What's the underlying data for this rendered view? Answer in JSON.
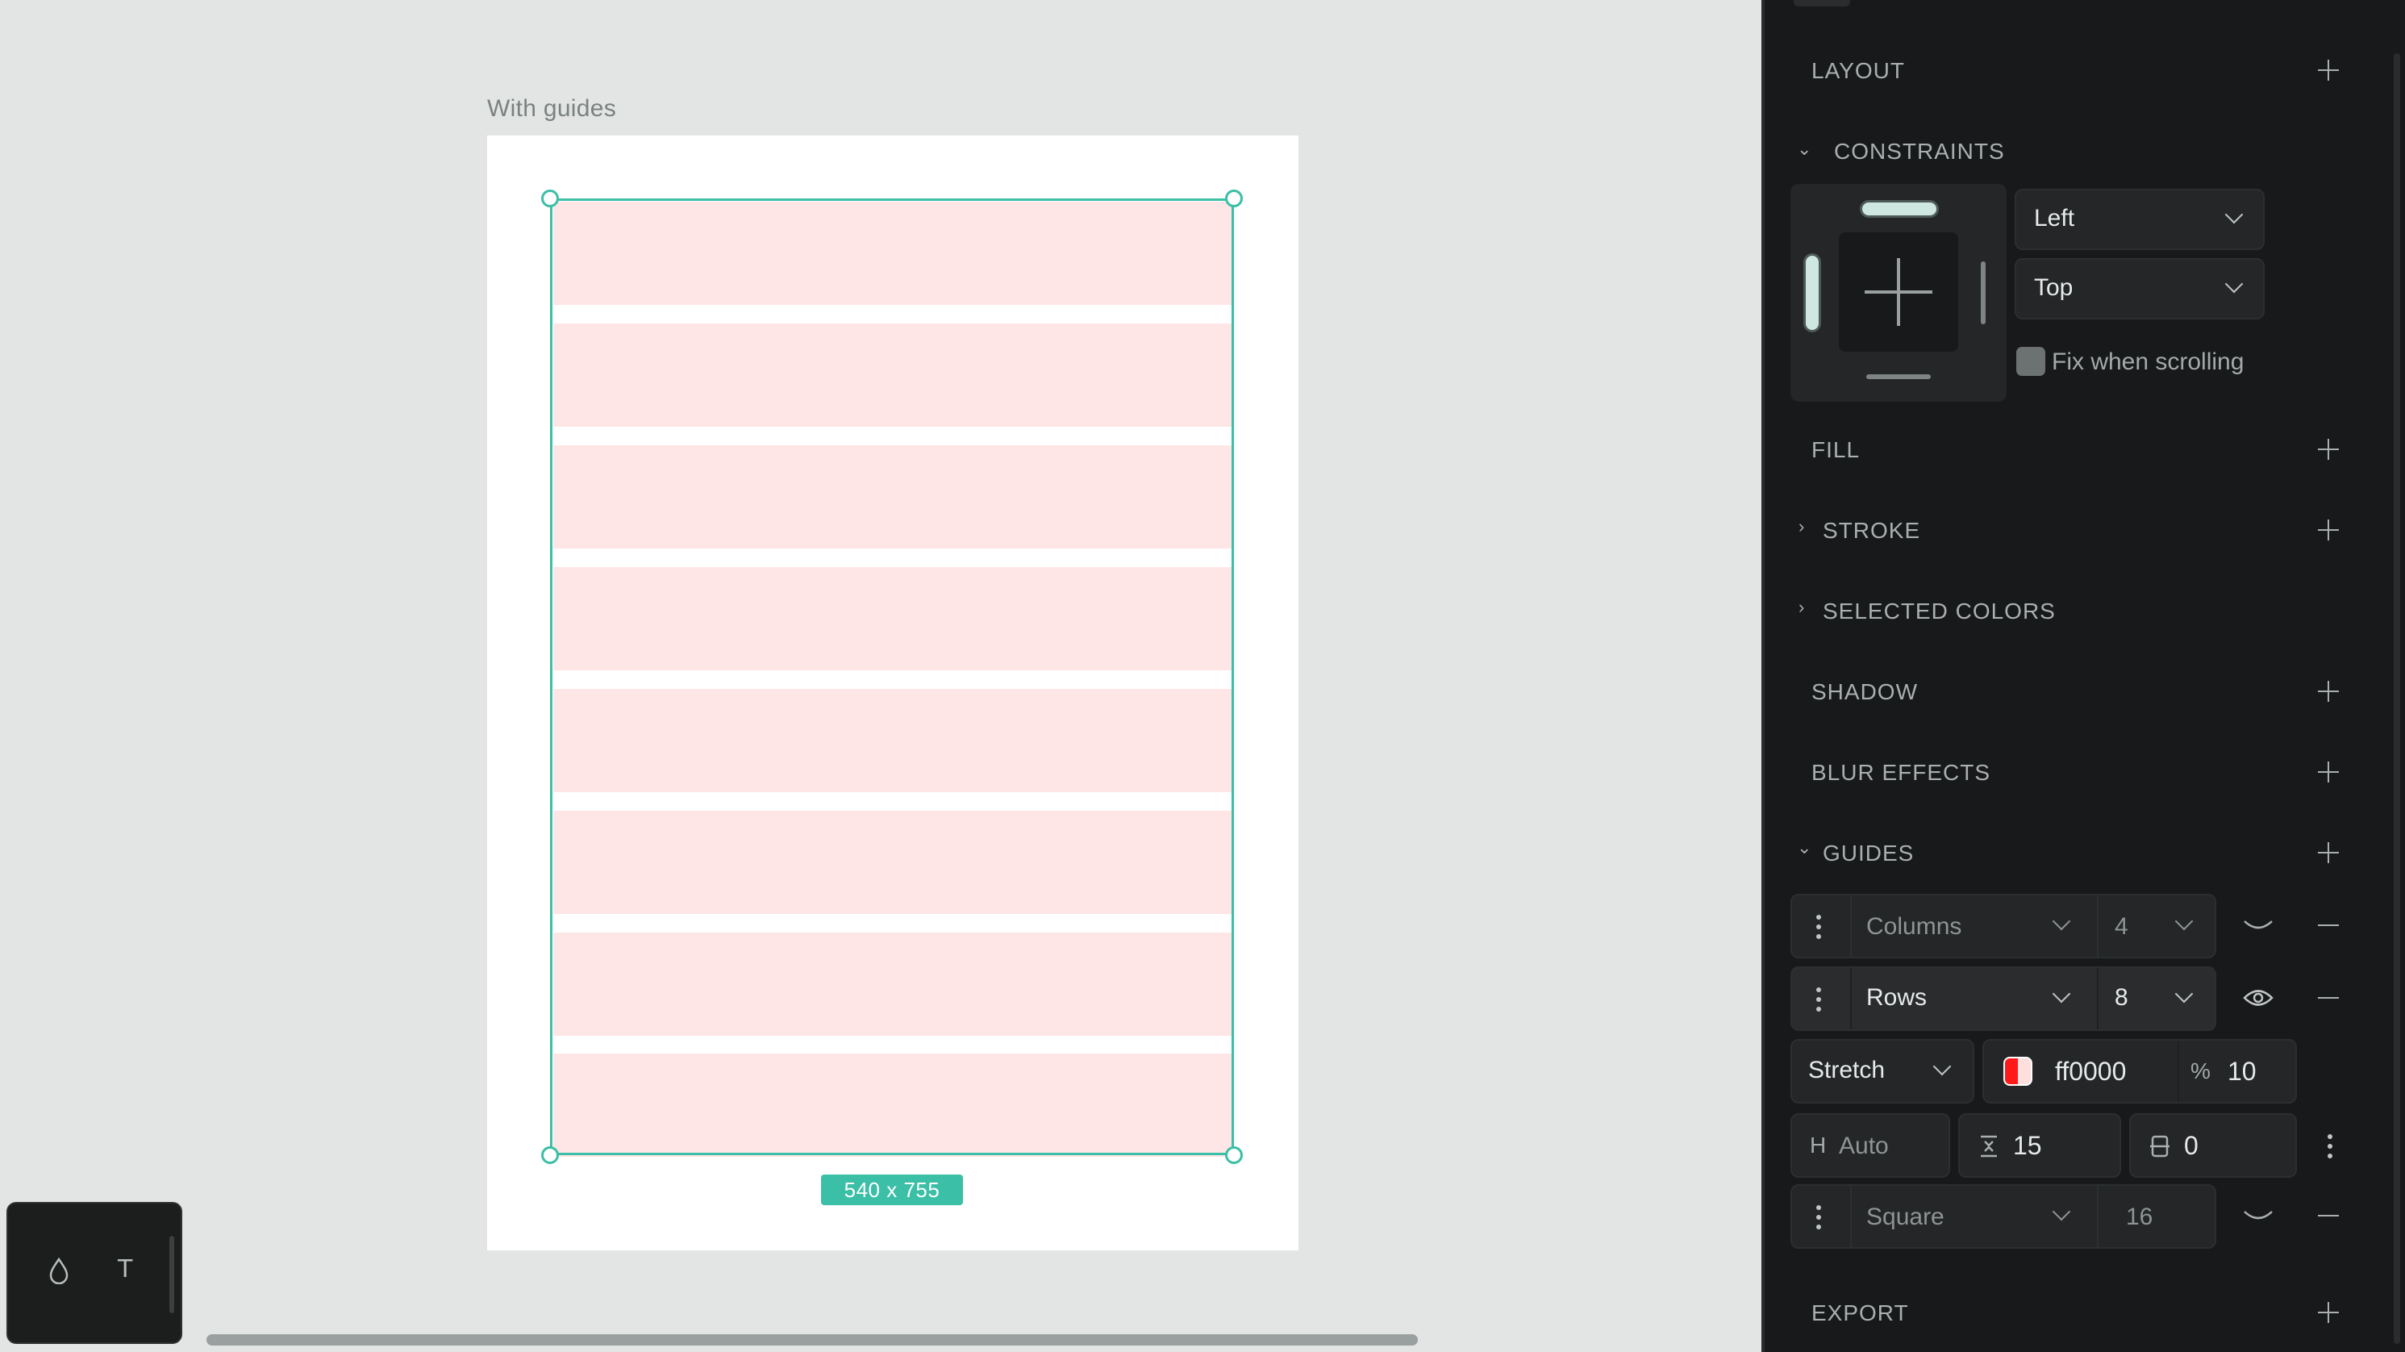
{
  "canvas": {
    "board_title": "With guides",
    "size_label": "540 x 755",
    "guide_rows": 8,
    "tools": {
      "fill_icon": "droplet-icon",
      "text_tool": "T"
    }
  },
  "panel": {
    "layout": {
      "title": "LAYOUT"
    },
    "constraints": {
      "title": "CONSTRAINTS",
      "horizontal": "Left",
      "vertical": "Top",
      "fix_when_scrolling": "Fix when scrolling"
    },
    "fill": {
      "title": "FILL"
    },
    "stroke": {
      "title": "STROKE"
    },
    "selected_colors": {
      "title": "SELECTED COLORS"
    },
    "shadow": {
      "title": "SHADOW"
    },
    "blur": {
      "title": "BLUR EFFECTS"
    },
    "guides": {
      "title": "GUIDES",
      "columns": {
        "type": "Columns",
        "count": "4"
      },
      "rows": {
        "type": "Rows",
        "count": "8"
      },
      "rows_settings": {
        "align": "Stretch",
        "color": "ff0000",
        "opacity_symbol": "%",
        "opacity": "10",
        "height_prefix": "H",
        "height": "Auto",
        "gutter": "15",
        "margin": "0"
      },
      "square": {
        "type": "Square",
        "size": "16"
      }
    },
    "export": {
      "title": "EXPORT"
    }
  },
  "colors": {
    "accent": "#3bbfa6",
    "guide_fill": "#fde6e5",
    "panel_bg": "#18191a",
    "canvas_bg": "#e3e5e4"
  }
}
